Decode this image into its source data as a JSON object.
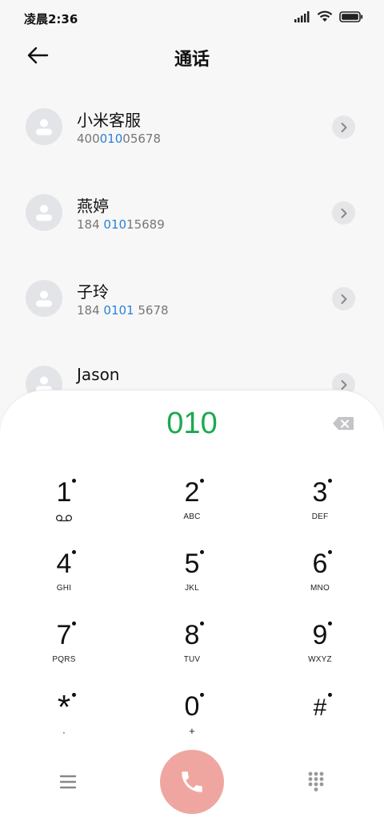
{
  "status_bar": {
    "time": "凌晨2:36"
  },
  "header": {
    "title": "通话"
  },
  "contacts": [
    {
      "name": "小米客服",
      "number_parts": [
        {
          "t": "400",
          "hl": false
        },
        {
          "t": "010",
          "hl": true
        },
        {
          "t": "05678",
          "hl": false
        }
      ]
    },
    {
      "name": "燕婷",
      "number_parts": [
        {
          "t": "184 ",
          "hl": false
        },
        {
          "t": "010",
          "hl": true
        },
        {
          "t": "15689",
          "hl": false
        }
      ]
    },
    {
      "name": "子玲",
      "number_parts": [
        {
          "t": "184 ",
          "hl": false
        },
        {
          "t": "0101",
          "hl": true
        },
        {
          "t": " 5678",
          "hl": false
        }
      ]
    },
    {
      "name": "Jason",
      "number_parts": []
    }
  ],
  "dialpad": {
    "input_value": "010",
    "keys": [
      {
        "digit": "1",
        "letters": "",
        "voicemail": true
      },
      {
        "digit": "2",
        "letters": "ABC"
      },
      {
        "digit": "3",
        "letters": "DEF"
      },
      {
        "digit": "4",
        "letters": "GHI"
      },
      {
        "digit": "5",
        "letters": "JKL"
      },
      {
        "digit": "6",
        "letters": "MNO"
      },
      {
        "digit": "7",
        "letters": "PQRS"
      },
      {
        "digit": "8",
        "letters": "TUV"
      },
      {
        "digit": "9",
        "letters": "WXYZ"
      },
      {
        "digit": "*",
        "letters": ","
      },
      {
        "digit": "0",
        "letters": "+"
      },
      {
        "digit": "#",
        "letters": ""
      }
    ]
  },
  "colors": {
    "accent_green": "#1aaa4f",
    "highlight_blue": "#2a82d8",
    "call_button": "#f0a6a0"
  },
  "icons": {
    "back": "arrow-left-icon",
    "arrow": "chevron-right-icon",
    "backspace": "backspace-icon",
    "call": "phone-icon",
    "menu": "hamburger-icon",
    "keypad": "keypad-icon"
  }
}
